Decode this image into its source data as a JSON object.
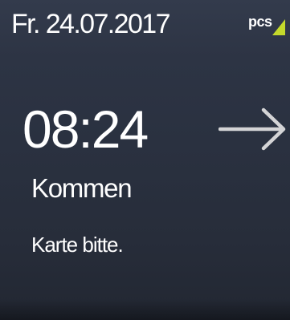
{
  "header": {
    "date": "Fr. 24.07.2017",
    "logo_text": "pcs",
    "logo_accent_color": "#c4d92b"
  },
  "main": {
    "time": "08:24",
    "direction_icon": "arrow-right-icon",
    "booking_type": "Kommen",
    "prompt": "Karte bitte."
  },
  "colors": {
    "background": "#2b3241",
    "text": "#ffffff",
    "arrow": "#d4d4d6"
  }
}
